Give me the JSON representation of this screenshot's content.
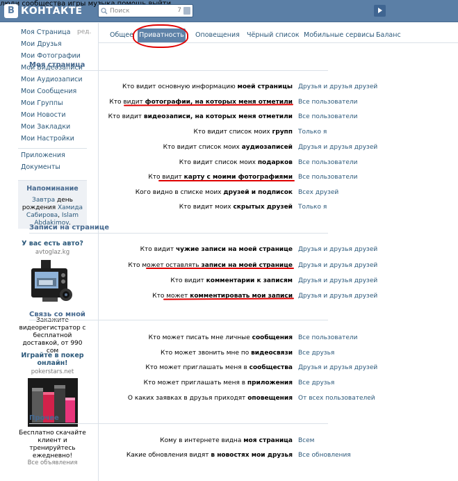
{
  "header": {
    "logo_letter": "В",
    "logo_text": "КОНТАКТЕ",
    "search_placeholder": "Поиск",
    "search_count": "7",
    "nav": [
      "люди",
      "сообщества",
      "игры",
      "музыка",
      "помощь",
      "выйти"
    ]
  },
  "sidebar": {
    "items": [
      "Моя Страница",
      "Мои Друзья",
      "Мои Фотографии",
      "Мои Видеозаписи",
      "Мои Аудиозаписи",
      "Мои Сообщения",
      "Мои Группы",
      "Мои Новости",
      "Мои Закладки",
      "Мои Настройки"
    ],
    "edit_label": "ред.",
    "extra_items": [
      "Приложения",
      "Документы"
    ],
    "reminder": {
      "title": "Напоминание",
      "text_prefix": "Завтра",
      "text_middle": "день рождения",
      "person1": "Хамида Сабирова",
      "separator": ",",
      "person2": "Islam Abdakimov",
      "suffix": "."
    },
    "ads": [
      {
        "title": "У вас есть авто?",
        "domain": "avtoglaz.kg",
        "text": "Закажите видеорегистратор с бесплатной доставкой, от 990 сом"
      },
      {
        "title": "Играйте в покер онлайн!",
        "domain": "pokerstars.net",
        "text": "Бесплатно скачайте клиент и тренируйтесь ежедневно!"
      }
    ],
    "all_ads": "Все объявления"
  },
  "tabs": [
    "Общее",
    "Приватность",
    "Оповещения",
    "Чёрный список",
    "Мобильные сервисы",
    "Баланс"
  ],
  "sections": [
    {
      "title": "Моя страница",
      "rows": [
        {
          "pre": "Кто видит основную информацию ",
          "bold": "моей страницы",
          "value": "Друзья и друзья друзей"
        },
        {
          "pre": "Кто видит ",
          "bold": "фотографии, на которых меня отметили",
          "value": "Все пользователи"
        },
        {
          "pre": "Кто видит ",
          "bold": "видеозаписи, на которых меня отметили",
          "value": "Все пользователи"
        },
        {
          "pre": "Кто видит список моих ",
          "bold": "групп",
          "value": "Только я"
        },
        {
          "pre": "Кто видит список моих ",
          "bold": "аудиозаписей",
          "value": "Друзья и друзья друзей"
        },
        {
          "pre": "Кто видит список моих ",
          "bold": "подарков",
          "value": "Все пользователи"
        },
        {
          "pre": "Кто видит ",
          "bold": "карту с моими фотографиями",
          "value": "Все пользователи"
        },
        {
          "pre": "Кого видно в списке моих ",
          "bold": "друзей и подписок",
          "value": "Всех друзей"
        },
        {
          "pre": "Кто видит моих ",
          "bold": "скрытых друзей",
          "value": "Только я"
        }
      ]
    },
    {
      "title": "Записи на странице",
      "rows": [
        {
          "pre": "Кто видит ",
          "bold": "чужие записи на моей странице",
          "value": "Друзья и друзья друзей"
        },
        {
          "pre": "Кто может оставлять ",
          "bold": "записи на моей странице",
          "value": "Друзья и друзья друзей"
        },
        {
          "pre": "Кто видит ",
          "bold": "комментарии к записям",
          "value": "Друзья и друзья друзей"
        },
        {
          "pre": "Кто может ",
          "bold": "комментировать мои записи",
          "value": "Друзья и друзья друзей"
        }
      ]
    },
    {
      "title": "Связь со мной",
      "rows": [
        {
          "pre": "Кто может писать мне личные ",
          "bold": "сообщения",
          "value": "Все пользователи"
        },
        {
          "pre": "Кто может звонить мне по ",
          "bold": "видеосвязи",
          "value": "Все друзья"
        },
        {
          "pre": "Кто может приглашать меня в ",
          "bold": "сообщества",
          "value": "Друзья и друзья друзей"
        },
        {
          "pre": "Кто может приглашать меня в ",
          "bold": "приложения",
          "value": "Все друзья"
        },
        {
          "pre": "О каких заявках в друзья приходят ",
          "bold": "оповещения",
          "value": "От всех пользователей"
        }
      ]
    },
    {
      "title": "Прочее",
      "rows": [
        {
          "pre": "Кому в интернете видна ",
          "bold": "моя страница",
          "value": "Всем"
        },
        {
          "pre": "Какие обновления видят ",
          "bold": "в новостях мои друзья",
          "value": "Все обновления"
        }
      ]
    }
  ],
  "colors": {
    "accent": "#5b7fa6",
    "link": "#2b587a",
    "annotation": "#e00000"
  }
}
